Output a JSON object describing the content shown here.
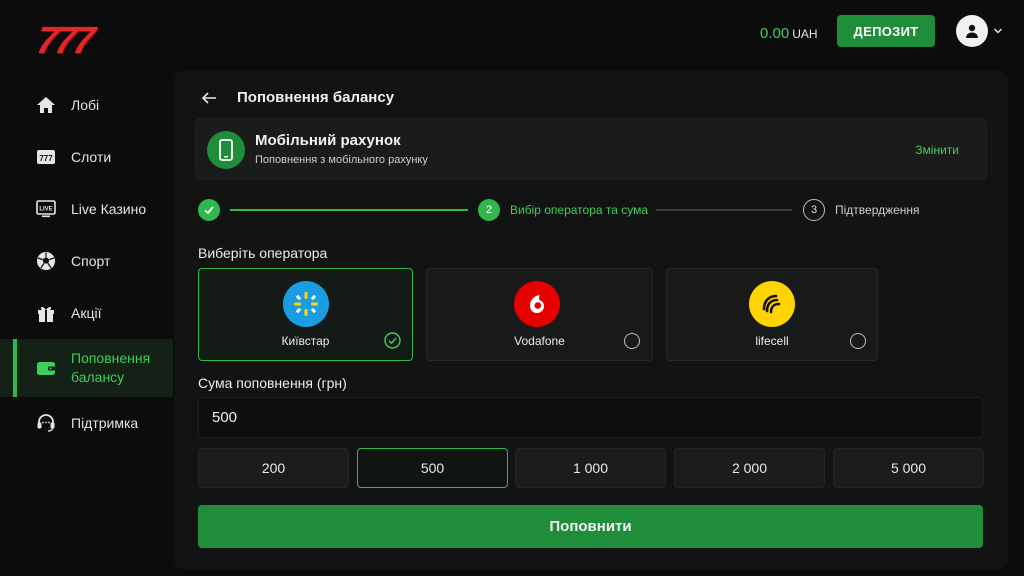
{
  "header": {
    "logo_text": "777",
    "balance_amount": "0.00",
    "balance_currency": "UAH",
    "deposit_label": "ДЕПОЗИТ"
  },
  "sidebar": {
    "items": [
      {
        "label": "Лобі",
        "icon": "home-icon"
      },
      {
        "label": "Слоти",
        "icon": "slots-777-icon"
      },
      {
        "label": "Live Казино",
        "icon": "live-tv-icon"
      },
      {
        "label": "Спорт",
        "icon": "soccer-ball-icon"
      },
      {
        "label": "Акції",
        "icon": "gift-icon"
      },
      {
        "label": "Поповнення балансу",
        "icon": "wallet-icon",
        "active": true
      },
      {
        "label": "Підтримка",
        "icon": "headset-icon"
      }
    ]
  },
  "page": {
    "title": "Поповнення балансу"
  },
  "method": {
    "name": "Мобільний рахунок",
    "subtitle": "Поповнення з мобільного рахунку",
    "change_label": "Змінити"
  },
  "stepper": {
    "step2_number": "2",
    "step2_label": "Вибір оператора та сума",
    "step3_number": "3",
    "step3_label": "Підтвердження"
  },
  "operators": {
    "section_label": "Виберіть оператора",
    "items": [
      {
        "name": "Київстар",
        "selected": true,
        "color": "#1b9de4"
      },
      {
        "name": "Vodafone",
        "selected": false,
        "color": "#e60000"
      },
      {
        "name": "lifecell",
        "selected": false,
        "color": "#ffd400"
      }
    ]
  },
  "amount": {
    "label": "Сума поповнення (грн)",
    "value": "500",
    "presets": [
      "200",
      "500",
      "1 000",
      "2 000",
      "5 000"
    ],
    "selected_preset": "500"
  },
  "submit_label": "Поповнити",
  "colors": {
    "accent": "#2fb84e",
    "button": "#1f8d3a",
    "brand_red": "#e3262b"
  }
}
